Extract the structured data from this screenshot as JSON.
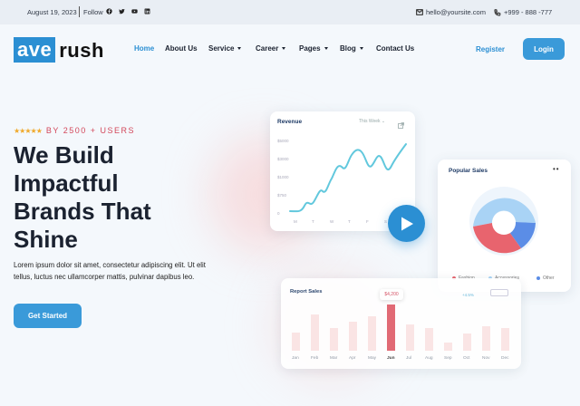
{
  "topbar": {
    "date": "August 19, 2023",
    "follow": "Follow",
    "social_icons": [
      "facebook-icon",
      "twitter-icon",
      "youtube-icon",
      "linkedin-icon"
    ],
    "email": "hello@yoursite.com",
    "phone": "+999 - 888 -777"
  },
  "logo": {
    "part1": "ave",
    "part2": "rush"
  },
  "nav": {
    "items": [
      {
        "label": "Home",
        "active": true,
        "dropdown": false
      },
      {
        "label": "About Us",
        "active": false,
        "dropdown": false
      },
      {
        "label": "Service",
        "active": false,
        "dropdown": true
      },
      {
        "label": "Career",
        "active": false,
        "dropdown": true
      },
      {
        "label": "Pages",
        "active": false,
        "dropdown": true
      },
      {
        "label": "Blog",
        "active": false,
        "dropdown": true
      },
      {
        "label": "Contact Us",
        "active": false,
        "dropdown": false
      }
    ],
    "register": "Register",
    "login": "Login"
  },
  "hero": {
    "rating_stars": 5,
    "users_text": "BY 2500 + USERS",
    "headline_lines": [
      "We Build",
      "Impactful",
      "Brands That",
      "Shine"
    ],
    "description": "Lorem ipsum dolor sit amet, consectetur adipiscing elit. Ut elit tellus, luctus nec ullamcorper mattis, pulvinar dapibus leo.",
    "cta": "Get Started"
  },
  "revenue_card": {
    "title": "Revenue",
    "period": "This Week",
    "y_labels": [
      "$5000",
      "$3000",
      "$1000",
      "$750",
      "0"
    ],
    "x_labels": [
      "M",
      "T",
      "W",
      "T",
      "F",
      "S"
    ]
  },
  "popular_sales": {
    "title": "Popular Sales",
    "legend": [
      {
        "label": "Fashion",
        "color": "#e8646e"
      },
      {
        "label": "Accessories",
        "color": "#a9d3f5"
      },
      {
        "label": "Other",
        "color": "#5b8de6"
      }
    ]
  },
  "report_sales": {
    "title": "Report Sales",
    "tooltip": "$4,200",
    "change": "+4.5%",
    "months": [
      "Jan",
      "Feb",
      "Mar",
      "Apr",
      "May",
      "Jun",
      "Jul",
      "Aug",
      "Sep",
      "Oct",
      "Nov",
      "Dec"
    ],
    "highlight_month": "Jun"
  },
  "colors": {
    "accent": "#2b8fd3",
    "headline": "#1b2230",
    "rating_text": "#d3475a",
    "star": "#f0a92a"
  }
}
